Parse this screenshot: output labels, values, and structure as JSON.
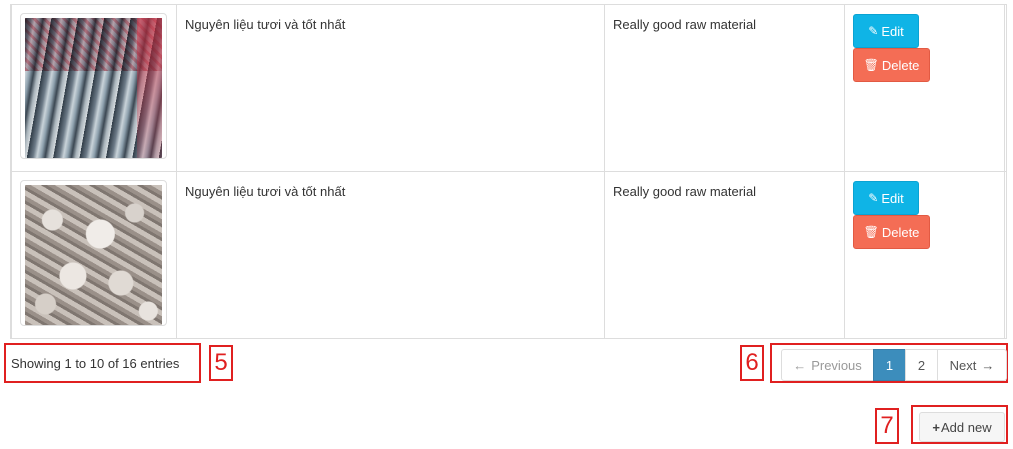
{
  "rows": [
    {
      "image": "fish-photo",
      "name": "Nguyên liệu tươi và tốt nhất",
      "description": "Really good raw material",
      "edit_label": "Edit",
      "delete_label": "Delete"
    },
    {
      "image": "squid-photo",
      "name": "Nguyên liệu tươi và tốt nhất",
      "description": "Really good raw material",
      "edit_label": "Edit",
      "delete_label": "Delete"
    }
  ],
  "icons": {
    "edit": "✎",
    "delete": "🗑",
    "prev_arrow": "←",
    "next_arrow": "→",
    "plus": "+"
  },
  "info": {
    "text": "Showing 1 to 10 of 16 entries"
  },
  "pagination": {
    "previous": "Previous",
    "pages": [
      "1",
      "2"
    ],
    "current": "1",
    "next": "Next"
  },
  "add_new": {
    "label": "Add new"
  },
  "markers": {
    "info": "5",
    "pagination": "6",
    "add": "7"
  },
  "colors": {
    "edit": "#0fb4e6",
    "delete": "#f46d55",
    "active_page": "#3c8dbc",
    "marker": "#e02020"
  }
}
